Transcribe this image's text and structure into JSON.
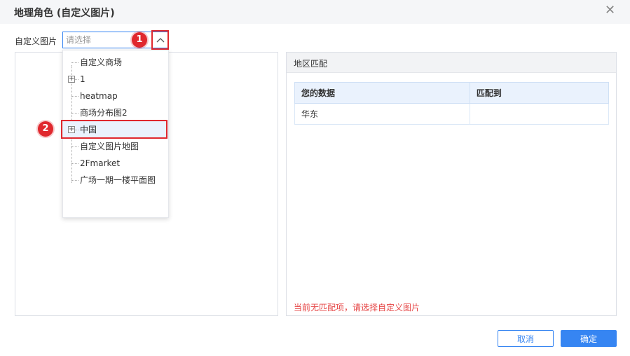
{
  "dialog": {
    "title": "地理角色 (自定义图片)",
    "close_glyph": "✕"
  },
  "selector": {
    "label": "自定义图片",
    "placeholder": "请选择",
    "value": ""
  },
  "callouts": {
    "one": "1",
    "two": "2"
  },
  "tree_items": [
    {
      "label": "自定义商场",
      "expandable": false
    },
    {
      "label": "1",
      "expandable": true
    },
    {
      "label": "heatmap",
      "expandable": false
    },
    {
      "label": "商场分布图2",
      "expandable": false
    },
    {
      "label": "中国",
      "expandable": true,
      "selected": true
    },
    {
      "label": "自定义图片地图",
      "expandable": false
    },
    {
      "label": "2Fmarket",
      "expandable": false
    },
    {
      "label": "广场一期一楼平面图",
      "expandable": false
    }
  ],
  "region_match": {
    "title": "地区匹配",
    "columns": [
      "您的数据",
      "匹配到"
    ],
    "rows": [
      [
        "华东",
        ""
      ]
    ],
    "warning": "当前无匹配项，请选择自定义图片"
  },
  "buttons": {
    "cancel": "取消",
    "ok": "确定"
  },
  "colors": {
    "accent": "#3685f2",
    "callout_red": "#e0282e",
    "warning_red": "#e64545"
  }
}
